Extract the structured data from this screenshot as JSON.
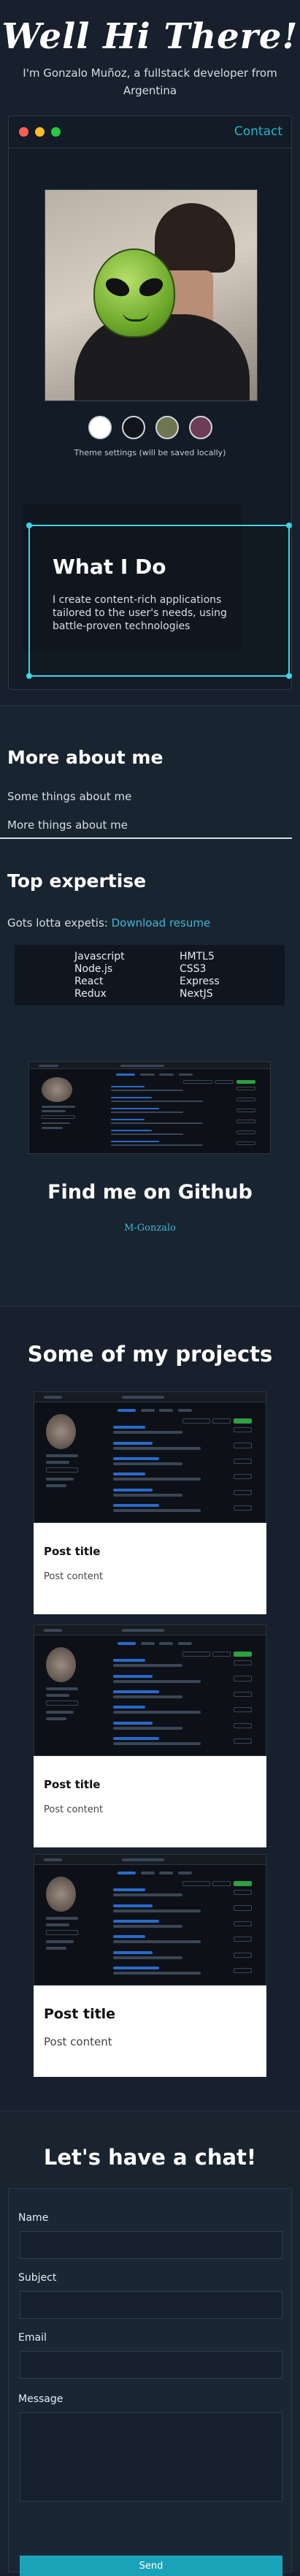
{
  "hero": {
    "title": "Well Hi There!",
    "subtitle": "I'm Gonzalo Muñoz, a fullstack developer from Argentina"
  },
  "window": {
    "contact_link": "Contact",
    "controls": [
      "close",
      "minimize",
      "maximize"
    ],
    "theme_swatches": [
      "#ffffff",
      "#111418",
      "#6e7650",
      "#6e3c55"
    ],
    "theme_note": "Theme settings (will be saved locally)",
    "widget": {
      "title": "What I Do",
      "text": "I create content-rich applications tailored to the user's needs, using battle-proven technologies"
    }
  },
  "about": {
    "title": "More about me",
    "line1": "Some things about me",
    "line2": "More things about me",
    "expertise_title": "Top expertise",
    "expertise_text": "Gots lotta expetis:",
    "download_link": "Download resume",
    "skills": [
      "Javascript",
      "HMTL5",
      "Node.js",
      "CSS3",
      "React",
      "Express",
      "Redux",
      "NextJS"
    ]
  },
  "github": {
    "title": "Find me on Github",
    "handle": "M-Gonzalo"
  },
  "projects": {
    "title": "Some of my projects",
    "cards": [
      {
        "title": "Post title",
        "content": "Post content"
      },
      {
        "title": "Post title",
        "content": "Post content"
      },
      {
        "title": "Post title",
        "content": "Post content"
      }
    ]
  },
  "contact": {
    "title": "Let's have a chat!",
    "name_label": "Name",
    "subject_label": "Subject",
    "email_label": "Email",
    "message_label": "Message",
    "name_value": "",
    "subject_value": "",
    "email_value": "",
    "message_value": "",
    "send_label": "Send"
  },
  "colors": {
    "background": "#17202c",
    "accent": "#22b5c9",
    "send_button": "#1aa3b8"
  }
}
